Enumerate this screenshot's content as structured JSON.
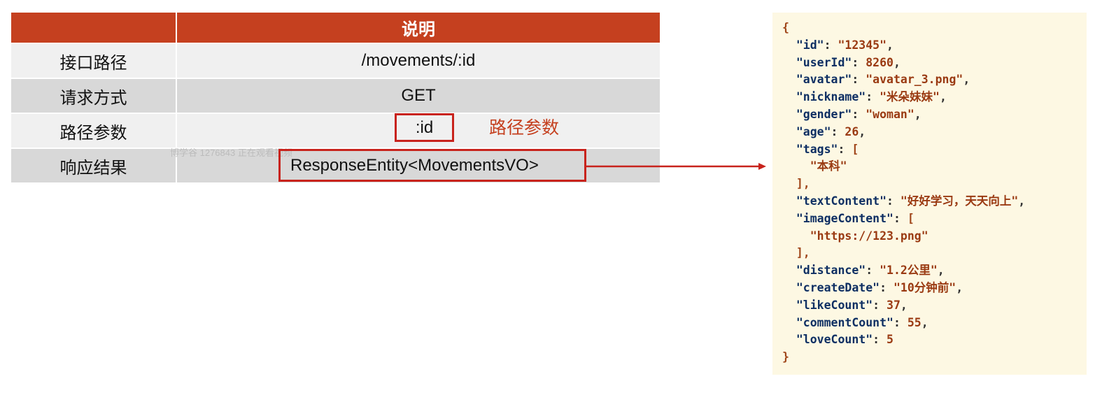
{
  "table": {
    "header": [
      "",
      "说明"
    ],
    "rows": [
      {
        "label": "接口路径",
        "value": "/movements/:id"
      },
      {
        "label": "请求方式",
        "value": "GET"
      },
      {
        "label": "路径参数",
        "value": ":id"
      },
      {
        "label": "响应结果",
        "value": "ResponseEntity<MovementsVO>"
      }
    ]
  },
  "annotation": {
    "path_param_label": "路径参数"
  },
  "watermark": "博学谷 1276843 正在观看视频",
  "json_sample": {
    "open_brace": "{",
    "close_brace": "}",
    "fields": [
      {
        "key": "\"id\"",
        "value": "\"12345\""
      },
      {
        "key": "\"userId\"",
        "value": "8260"
      },
      {
        "key": "\"avatar\"",
        "value": "\"avatar_3.png\""
      },
      {
        "key": "\"nickname\"",
        "value": "\"米朵妹妹\""
      },
      {
        "key": "\"gender\"",
        "value": "\"woman\""
      },
      {
        "key": "\"age\"",
        "value": "26"
      },
      {
        "key": "\"tags\"",
        "items": [
          "\"本科\""
        ]
      },
      {
        "key": "\"textContent\"",
        "value": "\"好好学习，天天向上\""
      },
      {
        "key": "\"imageContent\"",
        "items": [
          "\"https://123.png\""
        ]
      },
      {
        "key": "\"distance\"",
        "value": "\"1.2公里\""
      },
      {
        "key": "\"createDate\"",
        "value": "\"10分钟前\""
      },
      {
        "key": "\"likeCount\"",
        "value": "37"
      },
      {
        "key": "\"commentCount\"",
        "value": "55"
      },
      {
        "key": "\"loveCount\"",
        "value": "5"
      }
    ]
  },
  "colors": {
    "header_bg": "#c5401f",
    "highlight_border": "#c8231c",
    "json_bg": "#fdf8e3"
  }
}
